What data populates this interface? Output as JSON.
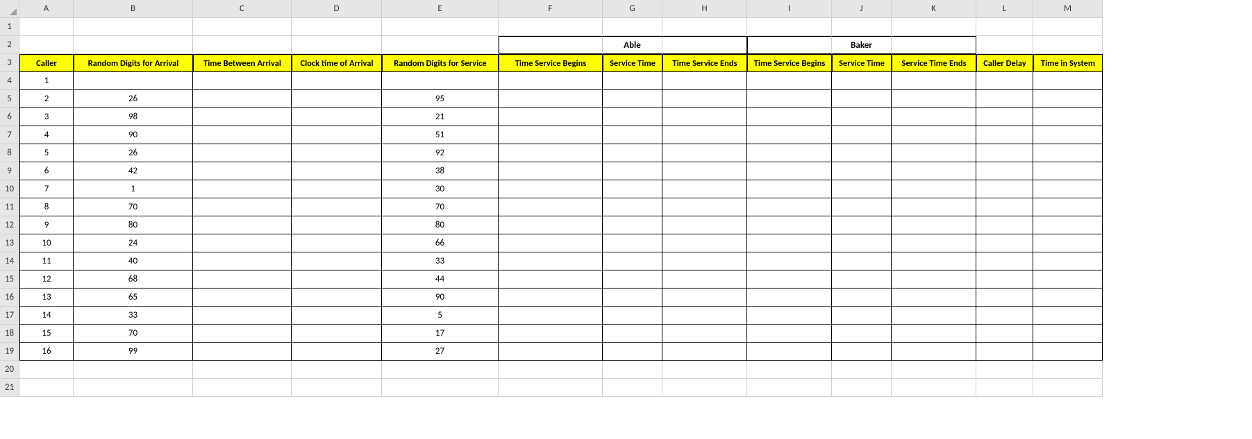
{
  "columns": [
    "A",
    "B",
    "C",
    "D",
    "E",
    "F",
    "G",
    "H",
    "I",
    "J",
    "K",
    "L",
    "M"
  ],
  "rows": [
    "1",
    "2",
    "3",
    "4",
    "5",
    "6",
    "7",
    "8",
    "9",
    "10",
    "11",
    "12",
    "13",
    "14",
    "15",
    "16",
    "17",
    "18",
    "19",
    "20",
    "21"
  ],
  "merge": {
    "able": "Able",
    "baker": "Baker"
  },
  "headers": {
    "A": "Caller",
    "B": "Random Digits for Arrival",
    "C": "Time Between Arrival",
    "D": "Clock time of Arrival",
    "E": "Random Digits for Service",
    "F": "Time Service Begins",
    "G": "Service Time",
    "H": "Time Service Ends",
    "I": "Time Service Begins",
    "J": "Service Time",
    "K": "Service Time Ends",
    "L": "Caller Delay",
    "M": "Time in System"
  },
  "chart_data": {
    "type": "table",
    "columns": [
      "Caller",
      "Random Digits for Arrival",
      "Time Between Arrival",
      "Clock time of Arrival",
      "Random Digits for Service",
      "Time Service Begins (Able)",
      "Service Time (Able)",
      "Time Service Ends (Able)",
      "Time Service Begins (Baker)",
      "Service Time (Baker)",
      "Service Time Ends (Baker)",
      "Caller Delay",
      "Time in System"
    ],
    "rows": [
      {
        "caller": 1,
        "rd_arrival": "",
        "rd_service": ""
      },
      {
        "caller": 2,
        "rd_arrival": 26,
        "rd_service": 95
      },
      {
        "caller": 3,
        "rd_arrival": 98,
        "rd_service": 21
      },
      {
        "caller": 4,
        "rd_arrival": 90,
        "rd_service": 51
      },
      {
        "caller": 5,
        "rd_arrival": 26,
        "rd_service": 92
      },
      {
        "caller": 6,
        "rd_arrival": 42,
        "rd_service": 38
      },
      {
        "caller": 7,
        "rd_arrival": 1,
        "rd_service": 30
      },
      {
        "caller": 8,
        "rd_arrival": 70,
        "rd_service": 70
      },
      {
        "caller": 9,
        "rd_arrival": 80,
        "rd_service": 80
      },
      {
        "caller": 10,
        "rd_arrival": 24,
        "rd_service": 66
      },
      {
        "caller": 11,
        "rd_arrival": 40,
        "rd_service": 33
      },
      {
        "caller": 12,
        "rd_arrival": 68,
        "rd_service": 44
      },
      {
        "caller": 13,
        "rd_arrival": 65,
        "rd_service": 90
      },
      {
        "caller": 14,
        "rd_arrival": 33,
        "rd_service": 5
      },
      {
        "caller": 15,
        "rd_arrival": 70,
        "rd_service": 17
      },
      {
        "caller": 16,
        "rd_arrival": 99,
        "rd_service": 27
      }
    ]
  }
}
